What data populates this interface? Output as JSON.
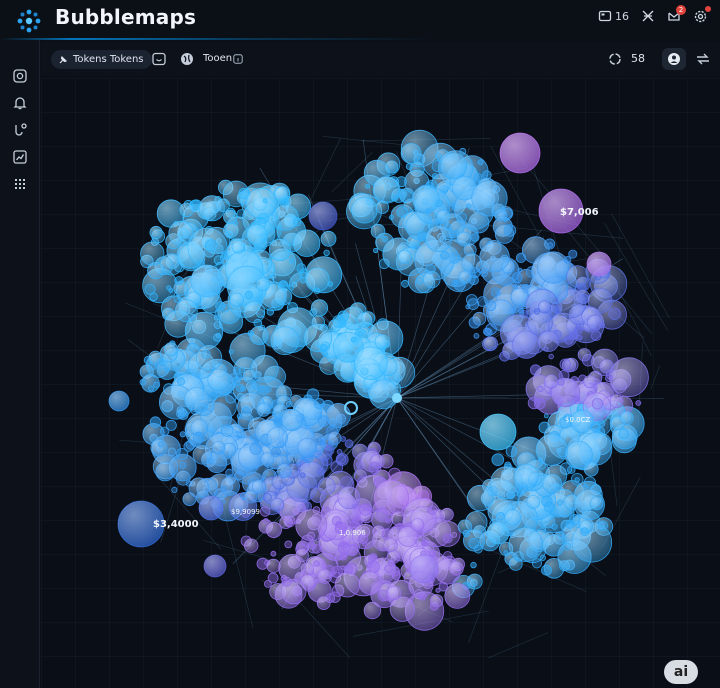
{
  "header": {
    "brand": "Bubblemaps",
    "count_label": "16",
    "notification_badge": "2"
  },
  "toolbar": {
    "tokens_chip": "Tokens Tokens",
    "token_label": "Tooen",
    "token_count": "58"
  },
  "canvas": {
    "labels": [
      {
        "text": "$7,006",
        "big": true
      },
      {
        "text": "$3,4000",
        "big": true
      },
      {
        "text": "1,0.906",
        "big": false
      },
      {
        "text": "$0.0CZ",
        "big": false
      },
      {
        "text": "$9,9099",
        "big": false
      }
    ]
  },
  "colors": {
    "accent_cyan": "#2fb8ff",
    "accent_violet": "#b46cf0",
    "background": "#0a0f17"
  },
  "assistant_badge": "ai"
}
